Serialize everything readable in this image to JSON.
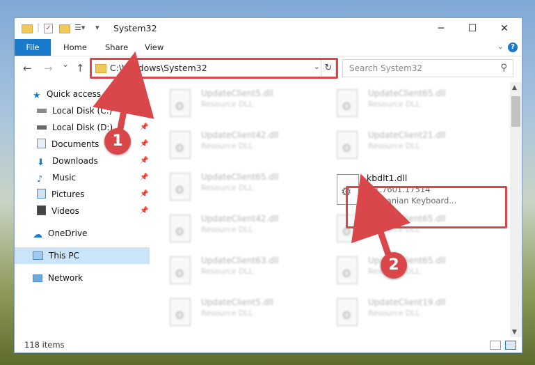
{
  "window": {
    "title": "System32",
    "minimize": "─",
    "maximize": "☐",
    "close": "✕"
  },
  "ribbon": {
    "file": "File",
    "tabs": [
      "Home",
      "Share",
      "View"
    ],
    "help": "?"
  },
  "nav": {
    "back": "←",
    "forward": "→",
    "recent": "⌄",
    "up": "↑"
  },
  "address": {
    "path": "C:\\Windows\\System32",
    "refresh": "↻"
  },
  "search": {
    "placeholder": "Search System32"
  },
  "sidebar": {
    "items": [
      {
        "label": "Quick access"
      },
      {
        "label": "Local Disk (C:)"
      },
      {
        "label": "Local Disk (D:)"
      },
      {
        "label": "Documents"
      },
      {
        "label": "Downloads"
      },
      {
        "label": "Music"
      },
      {
        "label": "Pictures"
      },
      {
        "label": "Videos"
      },
      {
        "label": "OneDrive"
      },
      {
        "label": "This PC"
      },
      {
        "label": "Network"
      }
    ]
  },
  "files": [
    {
      "name": "UpdateClient5.dll",
      "type": "Resource DLL"
    },
    {
      "name": "UpdateClient65.dll",
      "type": "Resource DLL"
    },
    {
      "name": "UpdateClient42.dll",
      "type": "Resource DLL"
    },
    {
      "name": "UpdateClient21.dll",
      "type": "Resource DLL"
    },
    {
      "name": "UpdateClient65.dll",
      "type": "Resource DLL"
    },
    {
      "name": "UpdateClient42.dll",
      "type": "Resource DLL"
    },
    {
      "name": "UpdateClient65.dll",
      "type": "Resource DLL"
    },
    {
      "name": "UpdateClient63.dll",
      "type": "Resource DLL"
    },
    {
      "name": "UpdateClient65.dll",
      "type": "Resource DLL"
    },
    {
      "name": "UpdateClient5.dll",
      "type": "Resource DLL"
    },
    {
      "name": "UpdateClient19.dll",
      "type": "Resource DLL"
    }
  ],
  "target_file": {
    "name": "kbdlt1.dll",
    "version": "6.1.7601.17514",
    "description": "Lithuanian Keyboard..."
  },
  "status": {
    "items": "118 items"
  },
  "callouts": {
    "one": "1",
    "two": "2"
  },
  "colors": {
    "accent": "#1979ca",
    "highlight": "#d9474b",
    "selection": "#cce4f7"
  }
}
